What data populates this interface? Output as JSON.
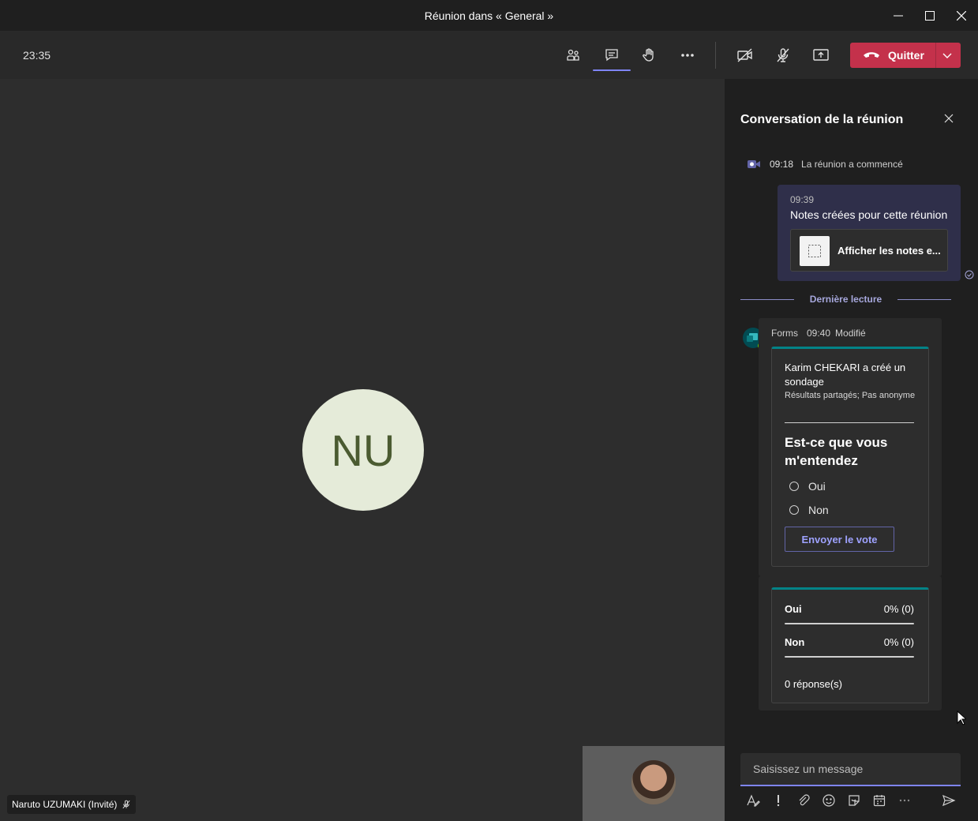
{
  "window": {
    "title": "Réunion dans « General »",
    "controls": [
      "minimize-icon",
      "maximize-icon",
      "close-icon"
    ]
  },
  "toolbar": {
    "time": "23:35",
    "buttons": [
      "participants-icon",
      "chat-icon",
      "raise-hand-icon",
      "more-icon",
      "camera-off-icon",
      "mic-off-icon",
      "share-screen-icon"
    ],
    "active_button": "chat-icon",
    "quit_label": "Quitter",
    "quit_color": "#c4314b"
  },
  "stage": {
    "avatar_initials": "NU",
    "avatar_bg": "#e5ebd9",
    "avatar_fg": "#4b5b31",
    "participant_name": "Naruto UZUMAKI (Invité)"
  },
  "chat": {
    "title": "Conversation de la réunion",
    "system_message": {
      "time": "09:18",
      "text": "La réunion a commencé"
    },
    "my_message": {
      "time": "09:39",
      "text": "Notes créées pour cette réunion",
      "card_label": "Afficher les notes e..."
    },
    "last_read_label": "Dernière lecture",
    "forms_message": {
      "sender": "Forms",
      "time": "09:40",
      "status": "Modifié",
      "poll": {
        "creator_text": "Karim CHEKARI a créé un sondage",
        "meta": "Résultats partagés; Pas anonyme",
        "question": "Est-ce que vous m'entendez",
        "options": [
          "Oui",
          "Non"
        ],
        "vote_button": "Envoyer le vote"
      },
      "results": {
        "rows": [
          {
            "label": "Oui",
            "value": "0% (0)"
          },
          {
            "label": "Non",
            "value": "0% (0)"
          }
        ],
        "total": "0 réponse(s)"
      }
    },
    "composer": {
      "placeholder": "Saisissez un message",
      "tools": [
        "format-icon",
        "important-icon",
        "attach-icon",
        "emoji-icon",
        "sticker-icon",
        "schedule-icon",
        "more-icon",
        "send-icon"
      ]
    }
  },
  "colors": {
    "accent": "#7f85f5",
    "forms_accent": "#038387",
    "danger": "#c4314b"
  }
}
